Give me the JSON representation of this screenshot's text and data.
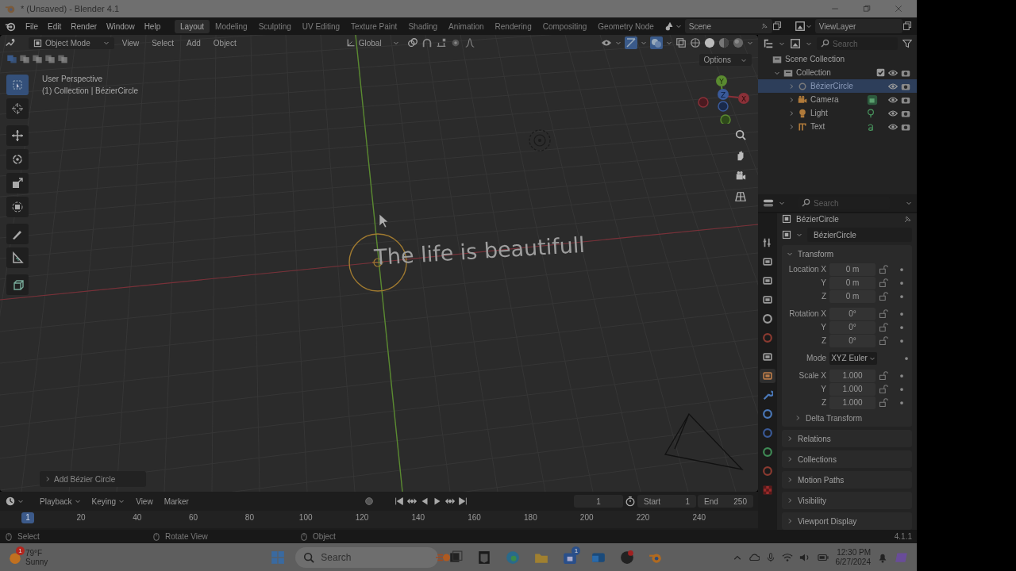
{
  "window": {
    "title": "* (Unsaved) - Blender 4.1"
  },
  "menu": [
    "File",
    "Edit",
    "Render",
    "Window",
    "Help"
  ],
  "workspaces": [
    {
      "label": "Layout",
      "selected": true
    },
    {
      "label": "Modeling",
      "selected": false
    },
    {
      "label": "Sculpting",
      "selected": false
    },
    {
      "label": "UV Editing",
      "selected": false
    },
    {
      "label": "Texture Paint",
      "selected": false
    },
    {
      "label": "Shading",
      "selected": false
    },
    {
      "label": "Animation",
      "selected": false
    },
    {
      "label": "Rendering",
      "selected": false
    },
    {
      "label": "Compositing",
      "selected": false
    },
    {
      "label": "Geometry Node",
      "selected": false
    }
  ],
  "scene_field": {
    "value": "Scene"
  },
  "view_layer_field": {
    "value": "ViewLayer"
  },
  "viewport": {
    "mode": "Object Mode",
    "menus": [
      "View",
      "Select",
      "Add",
      "Object"
    ],
    "orientation": "Global",
    "options": "Options",
    "overlay_lines": [
      "User Perspective",
      "(1) Collection | BézierCircle"
    ],
    "scene_text": "The life is beautifull",
    "gizmo_labels": [
      "X",
      "Y",
      "Z"
    ],
    "last_operator": "Add Bézier Circle"
  },
  "outliner": {
    "search_placeholder": "Search",
    "root": "Scene Collection",
    "collection": {
      "label": "Collection",
      "expanded": true,
      "checked": true,
      "children": [
        {
          "label": "BézierCircle",
          "kind": "curve",
          "selected": true
        },
        {
          "label": "Camera",
          "kind": "camera",
          "selected": false
        },
        {
          "label": "Light",
          "kind": "light",
          "selected": false
        },
        {
          "label": "Text",
          "kind": "text",
          "selected": false
        }
      ]
    }
  },
  "properties": {
    "search_placeholder": "Search",
    "object_name": "BézierCircle",
    "datablock": "BézierCircle",
    "tabs": [
      {
        "kind": "tool",
        "selected": false
      },
      {
        "kind": "render",
        "selected": false
      },
      {
        "kind": "output",
        "selected": false
      },
      {
        "kind": "view_layer",
        "selected": false
      },
      {
        "kind": "scene",
        "selected": false
      },
      {
        "kind": "world",
        "selected": false
      },
      {
        "kind": "collection",
        "selected": false
      },
      {
        "kind": "object",
        "selected": true
      },
      {
        "kind": "modifiers",
        "selected": false
      },
      {
        "kind": "particles",
        "selected": false
      },
      {
        "kind": "physics",
        "selected": false
      },
      {
        "kind": "constraints",
        "selected": false
      },
      {
        "kind": "material",
        "selected": false
      },
      {
        "kind": "texture",
        "selected": false
      }
    ],
    "transform": {
      "title": "Transform",
      "expanded": true,
      "rows": [
        {
          "label": "Location X",
          "value": "0 m",
          "kind": "number"
        },
        {
          "label": "Y",
          "value": "0 m",
          "kind": "number"
        },
        {
          "label": "Z",
          "value": "0 m",
          "kind": "number"
        },
        {
          "label": "Rotation X",
          "value": "0°",
          "kind": "number"
        },
        {
          "label": "Y",
          "value": "0°",
          "kind": "number"
        },
        {
          "label": "Z",
          "value": "0°",
          "kind": "number"
        },
        {
          "label": "Mode",
          "value": "XYZ Euler",
          "kind": "dropdown"
        },
        {
          "label": "Scale X",
          "value": "1.000",
          "kind": "number"
        },
        {
          "label": "Y",
          "value": "1.000",
          "kind": "number"
        },
        {
          "label": "Z",
          "value": "1.000",
          "kind": "number"
        }
      ],
      "subpanel": {
        "title": "Delta Transform",
        "expanded": false
      }
    },
    "panels": [
      {
        "title": "Relations",
        "expanded": false
      },
      {
        "title": "Collections",
        "expanded": false
      },
      {
        "title": "Motion Paths",
        "expanded": false
      },
      {
        "title": "Visibility",
        "expanded": false
      },
      {
        "title": "Viewport Display",
        "expanded": false
      }
    ]
  },
  "timeline": {
    "menus": [
      "Playback",
      "Keying",
      "View",
      "Marker"
    ],
    "current_frame": "1",
    "start_label": "Start",
    "start": "1",
    "end_label": "End",
    "end": "250",
    "ruler_current": "1",
    "ruler": [
      "20",
      "40",
      "60",
      "80",
      "100",
      "120",
      "140",
      "160",
      "180",
      "200",
      "220",
      "240"
    ]
  },
  "status_bar": {
    "items": [
      "Select",
      "Rotate View",
      "Object"
    ],
    "version": "4.1.1"
  },
  "taskbar": {
    "temperature": "79°F",
    "condition": "Sunny",
    "weather_badge": "1",
    "search_placeholder": "Search",
    "store_badge": "1",
    "time": "12:30 PM",
    "date": "6/27/2024"
  }
}
